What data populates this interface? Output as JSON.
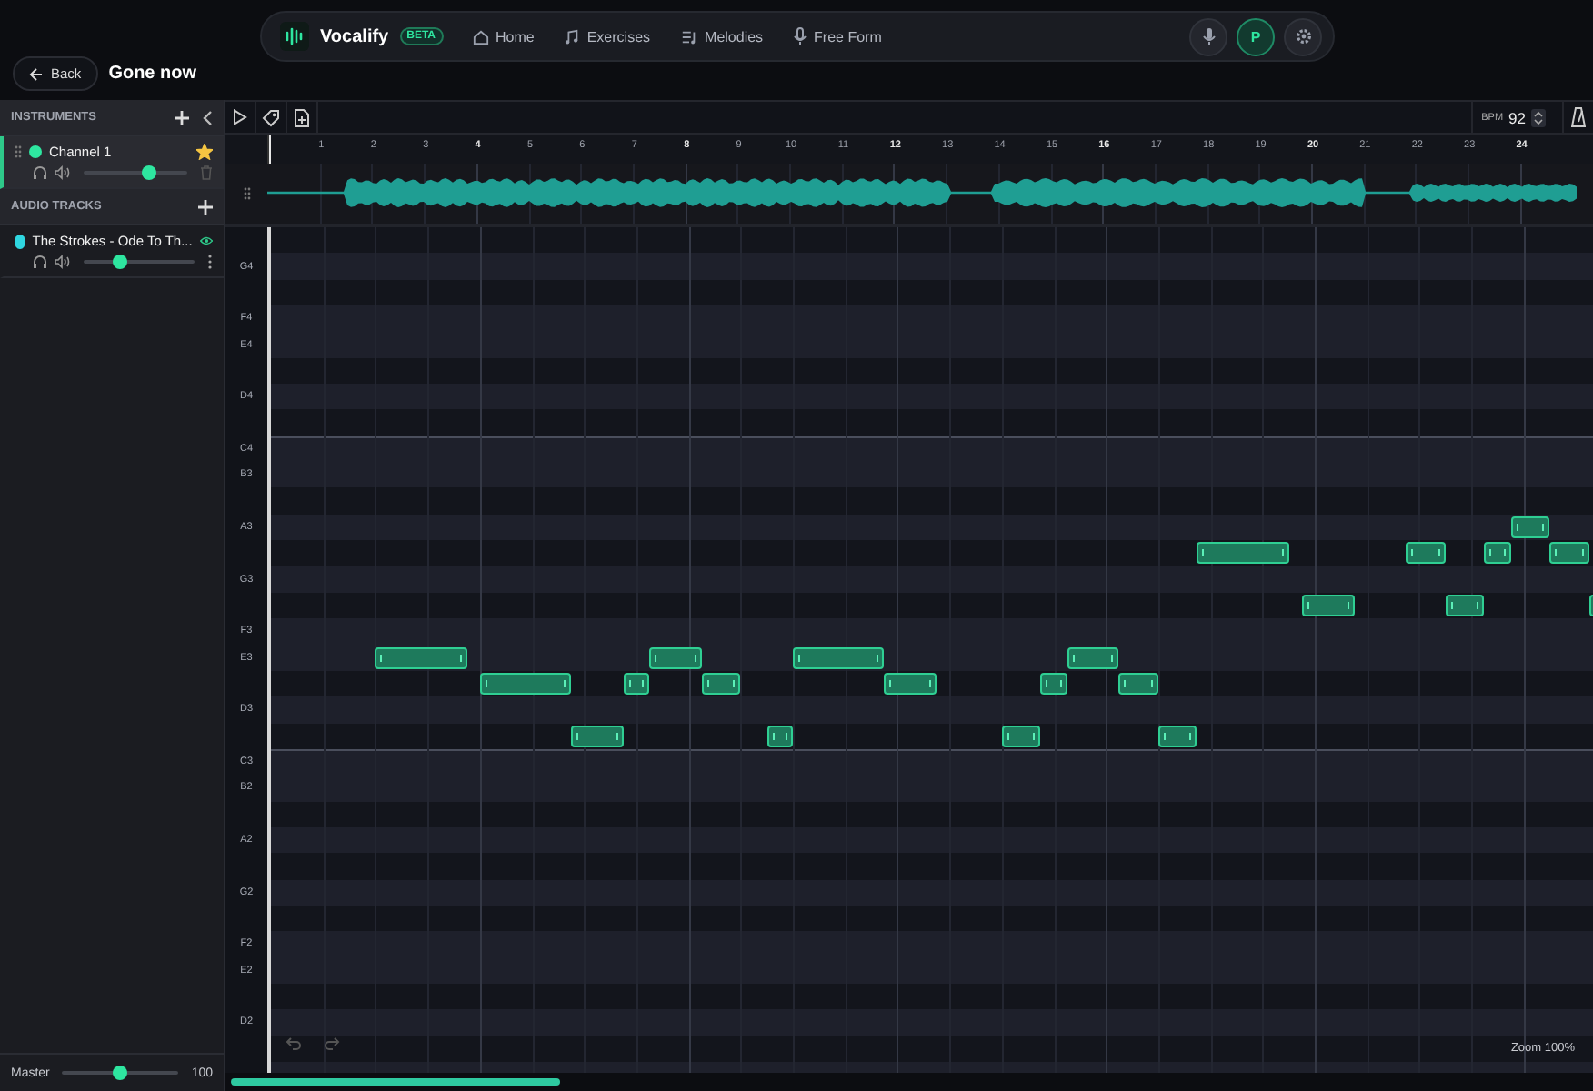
{
  "nav": {
    "brand": "Vocalify",
    "badge": "BETA",
    "links": [
      {
        "label": "Home",
        "kind": "home"
      },
      {
        "label": "Exercises",
        "kind": "music"
      },
      {
        "label": "Melodies",
        "kind": "list"
      },
      {
        "label": "Free Form",
        "kind": "mic"
      }
    ],
    "avatar": "P"
  },
  "header": {
    "back": "Back",
    "title": "Gone now"
  },
  "sidebar": {
    "instruments_title": "INSTRUMENTS",
    "instruments": [
      {
        "name": "Channel 1",
        "color": "#2ee6a0",
        "selected": true,
        "starred": true,
        "level": 0.64
      }
    ],
    "audio_title": "AUDIO TRACKS",
    "audio_tracks": [
      {
        "name": "The Strokes - Ode To Th...",
        "color": "#2fd6e0",
        "visible": true,
        "level": 0.32
      }
    ],
    "master": {
      "label": "Master",
      "level": 0.5,
      "value": "100"
    }
  },
  "toolbar": {
    "bpm_label": "BPM",
    "bpm": "92"
  },
  "ruler": [
    {
      "label": "1",
      "major": false
    },
    {
      "label": "2",
      "major": false
    },
    {
      "label": "3",
      "major": false
    },
    {
      "label": "4",
      "major": true
    },
    {
      "label": "5",
      "major": false
    },
    {
      "label": "6",
      "major": false
    },
    {
      "label": "7",
      "major": false
    },
    {
      "label": "8",
      "major": true
    },
    {
      "label": "9",
      "major": false
    },
    {
      "label": "10",
      "major": false
    },
    {
      "label": "11",
      "major": false
    },
    {
      "label": "12",
      "major": true
    },
    {
      "label": "13",
      "major": false
    },
    {
      "label": "14",
      "major": false
    },
    {
      "label": "15",
      "major": false
    },
    {
      "label": "16",
      "major": true
    },
    {
      "label": "17",
      "major": false
    },
    {
      "label": "18",
      "major": false
    },
    {
      "label": "19",
      "major": false
    },
    {
      "label": "20",
      "major": true
    },
    {
      "label": "21",
      "major": false
    },
    {
      "label": "22",
      "major": false
    },
    {
      "label": "23",
      "major": false
    },
    {
      "label": "24",
      "major": true
    }
  ],
  "rows": [
    {
      "kind": "black"
    },
    {
      "kind": "white",
      "label": "G4"
    },
    {
      "kind": "black"
    },
    {
      "kind": "white",
      "label": "F4"
    },
    {
      "kind": "white",
      "label": "E4"
    },
    {
      "kind": "black"
    },
    {
      "kind": "white",
      "label": "D4"
    },
    {
      "kind": "black"
    },
    {
      "kind": "white",
      "label": "C4",
      "octave": true
    },
    {
      "kind": "white",
      "label": "B3"
    },
    {
      "kind": "black"
    },
    {
      "kind": "white",
      "label": "A3"
    },
    {
      "kind": "black"
    },
    {
      "kind": "white",
      "label": "G3"
    },
    {
      "kind": "black"
    },
    {
      "kind": "white",
      "label": "F3"
    },
    {
      "kind": "white",
      "label": "E3"
    },
    {
      "kind": "black"
    },
    {
      "kind": "white",
      "label": "D3"
    },
    {
      "kind": "black"
    },
    {
      "kind": "white",
      "label": "C3",
      "octave": true
    },
    {
      "kind": "white",
      "label": "B2"
    },
    {
      "kind": "black"
    },
    {
      "kind": "white",
      "label": "A2"
    },
    {
      "kind": "black"
    },
    {
      "kind": "white",
      "label": "G2"
    },
    {
      "kind": "black"
    },
    {
      "kind": "white",
      "label": "F2"
    },
    {
      "kind": "white",
      "label": "E2"
    },
    {
      "kind": "black"
    },
    {
      "kind": "white",
      "label": "D2"
    },
    {
      "kind": "black"
    },
    {
      "kind": "white"
    }
  ],
  "zoom": "Zoom 100%"
}
